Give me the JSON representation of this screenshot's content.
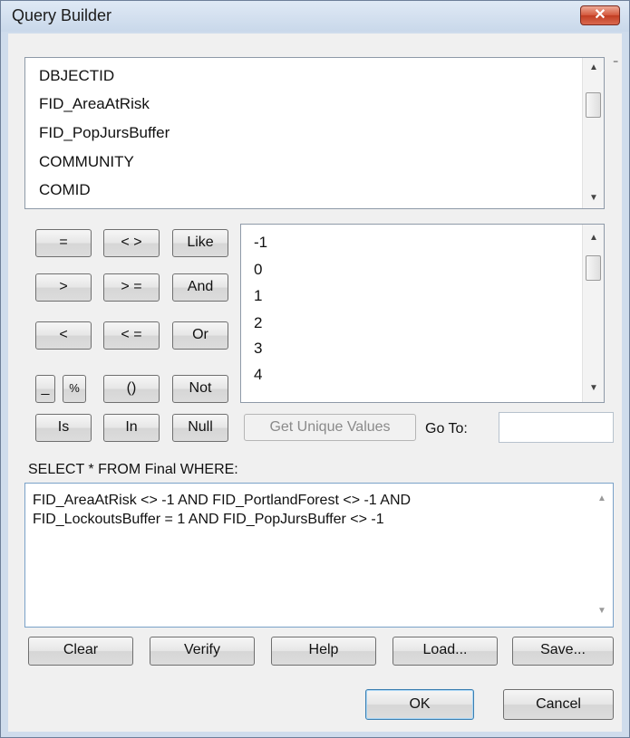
{
  "window": {
    "title": "Query Builder",
    "close_glyph": "✕"
  },
  "fields": {
    "items": [
      "DBJECTID",
      "FID_AreaAtRisk",
      "FID_PopJursBuffer",
      "COMMUNITY",
      "COMID"
    ]
  },
  "operators": {
    "equals": "=",
    "not_equal": "< >",
    "like": "Like",
    "greater": ">",
    "greater_equal": "> =",
    "and": "And",
    "less": "<",
    "less_equal": "< =",
    "or": "Or",
    "underscore": "_",
    "percent": "%",
    "parens": "()",
    "not": "Not",
    "is": "Is",
    "in": "In",
    "null": "Null"
  },
  "values": {
    "items": [
      "-1",
      "0",
      "1",
      "2",
      "3",
      "4"
    ]
  },
  "unique_values": {
    "get_label": "Get Unique Values",
    "goto_label": "Go To:",
    "goto_value": ""
  },
  "query": {
    "prefix": "SELECT * FROM Final WHERE:",
    "expression": "FID_AreaAtRisk <> -1 AND FID_PortlandForest <> -1 AND\nFID_LockoutsBuffer = 1 AND FID_PopJursBuffer <> -1"
  },
  "actions": {
    "clear": "Clear",
    "verify": "Verify",
    "help": "Help",
    "load": "Load...",
    "save": "Save..."
  },
  "dialog": {
    "ok": "OK",
    "cancel": "Cancel"
  }
}
